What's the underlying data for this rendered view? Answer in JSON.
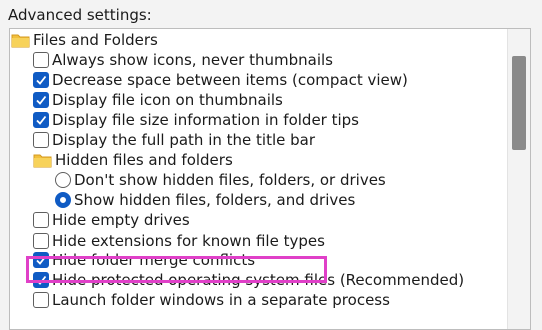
{
  "heading": "Advanced settings:",
  "folder_label": "Files and Folders",
  "items": {
    "always_show_icons": {
      "label": "Always show icons, never thumbnails",
      "checked": false
    },
    "decrease_space": {
      "label": "Decrease space between items (compact view)",
      "checked": true
    },
    "display_file_icon": {
      "label": "Display file icon on thumbnails",
      "checked": true
    },
    "display_file_size": {
      "label": "Display file size information in folder tips",
      "checked": true
    },
    "display_full_path": {
      "label": "Display the full path in the title bar",
      "checked": false
    },
    "hidden_files_group": {
      "label": "Hidden files and folders"
    },
    "dont_show_hidden": {
      "label": "Don't show hidden files, folders, or drives",
      "selected": false
    },
    "show_hidden": {
      "label": "Show hidden files, folders, and drives",
      "selected": true
    },
    "hide_empty_drives": {
      "label": "Hide empty drives",
      "checked": false
    },
    "hide_extensions": {
      "label": "Hide extensions for known file types",
      "checked": false
    },
    "hide_merge_conflicts": {
      "label": "Hide folder merge conflicts",
      "checked": true
    },
    "hide_protected_os": {
      "label": "Hide protected operating system files (Recommended)",
      "checked": true
    },
    "launch_separate": {
      "label": "Launch folder windows in a separate process",
      "checked": false
    }
  },
  "colors": {
    "accent": "#0f5bc4",
    "highlight": "#e040c8",
    "folder": "#f2c03d"
  },
  "icons": {
    "folder": "folder-icon",
    "checkbox": "checkbox-icon",
    "radio": "radio-icon",
    "check": "checkmark-icon"
  }
}
